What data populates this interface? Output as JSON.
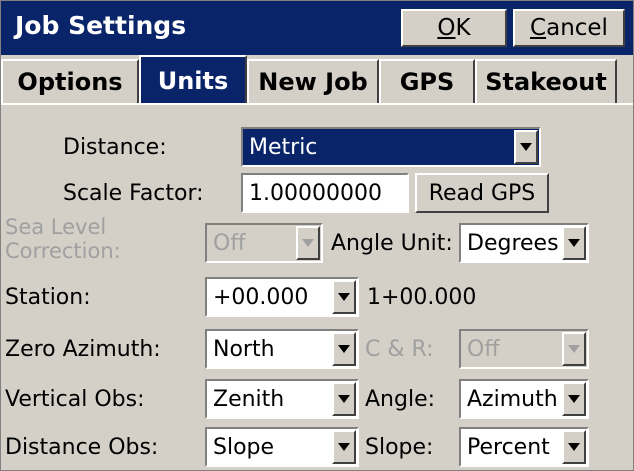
{
  "window": {
    "title": "Job Settings",
    "ok_label": "OK",
    "ok_underline": "O",
    "ok_rest": "K",
    "cancel_underline": "C",
    "cancel_rest": "ancel"
  },
  "tabs": [
    {
      "label": "Options",
      "active": false
    },
    {
      "label": "Units",
      "active": true
    },
    {
      "label": "New Job",
      "active": false
    },
    {
      "label": "GPS",
      "active": false
    },
    {
      "label": "Stakeout",
      "active": false
    }
  ],
  "form": {
    "distance": {
      "label": "Distance:",
      "value": "Metric"
    },
    "scale_factor": {
      "label": "Scale Factor:",
      "value": "1.00000000",
      "button": "Read GPS"
    },
    "sea_level": {
      "label_line1": "Sea Level",
      "label_line2": "Correction:",
      "value": "Off",
      "enabled": false
    },
    "angle_unit": {
      "label": "Angle Unit:",
      "value": "Degrees"
    },
    "station": {
      "label": "Station:",
      "value": "+00.000",
      "readout": "1+00.000"
    },
    "zero_azimuth": {
      "label": "Zero Azimuth:",
      "value": "North"
    },
    "c_and_r": {
      "label": "C & R:",
      "value": "Off",
      "enabled": false
    },
    "vertical_obs": {
      "label": "Vertical Obs:",
      "value": "Zenith"
    },
    "angle": {
      "label": "Angle:",
      "value": "Azimuth"
    },
    "distance_obs": {
      "label": "Distance Obs:",
      "value": "Slope"
    },
    "slope": {
      "label": "Slope:",
      "value": "Percent"
    }
  },
  "colors": {
    "titlebar": "#0a246a",
    "face": "#d4d0c8",
    "disabled_text": "#a0a0a0"
  },
  "icons": {
    "dropdown": "chevron-down-icon"
  }
}
